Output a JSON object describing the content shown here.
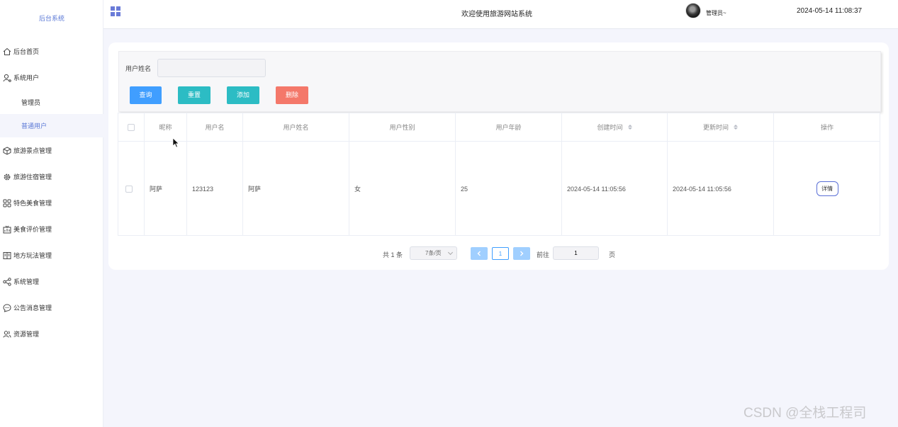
{
  "sidebar": {
    "brand": "后台系统",
    "items": [
      {
        "label": "后台首页",
        "icon": "home-icon"
      },
      {
        "label": "系统用户",
        "icon": "user-icon"
      },
      {
        "label": "旅游景点管理",
        "icon": "cube-icon"
      },
      {
        "label": "旅游住宿管理",
        "icon": "gear-icon"
      },
      {
        "label": "特色美食管理",
        "icon": "grid-icon"
      },
      {
        "label": "美食评价管理",
        "icon": "chart-box-icon"
      },
      {
        "label": "地方玩法管理",
        "icon": "book-icon"
      },
      {
        "label": "系统管理",
        "icon": "share-icon"
      },
      {
        "label": "公告消息管理",
        "icon": "chat-icon"
      },
      {
        "label": "资源管理",
        "icon": "users-icon"
      }
    ],
    "sub_items": [
      {
        "label": "管理员"
      },
      {
        "label": "普通用户",
        "active": true
      }
    ]
  },
  "header": {
    "title": "欢迎使用旅游网站系统",
    "user": "管理员",
    "datetime": "2024-05-14 11:08:37"
  },
  "search": {
    "label": "用户姓名",
    "value": "",
    "buttons": {
      "query": "查询",
      "reset": "重置",
      "add": "添加",
      "delete": "删除"
    }
  },
  "table": {
    "columns": [
      "昵称",
      "用户名",
      "用户姓名",
      "用户性别",
      "用户年龄",
      "创建时间",
      "更新时间",
      "操作"
    ],
    "rows": [
      [
        "阿萨",
        "123123",
        "阿萨",
        "女",
        "25",
        "2024-05-14 11:05:56",
        "2024-05-14 11:05:56",
        "详情"
      ]
    ]
  },
  "pagination": {
    "total": "共 1 条",
    "page_size": "7条/页",
    "current_page": "1",
    "goto_label": "前往",
    "goto_value": "1",
    "page_suffix": "页"
  },
  "watermark": "CSDN @全栈工程司",
  "colors": {
    "primary": "#409eff",
    "teal": "#2cbcc4",
    "danger": "#f4786a",
    "accent": "#5a78d6"
  }
}
